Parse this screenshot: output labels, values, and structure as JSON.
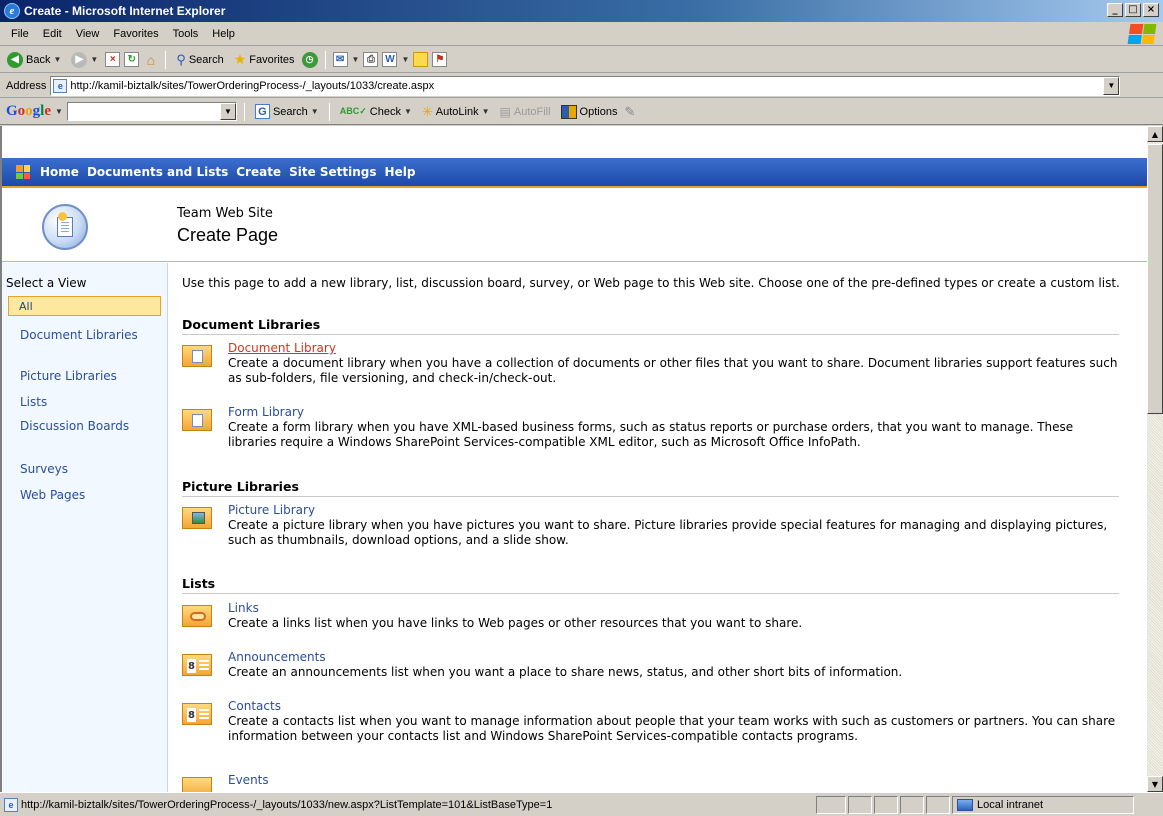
{
  "window": {
    "title": "Create - Microsoft Internet Explorer",
    "minimize": "_",
    "maximize": "□",
    "close": "×"
  },
  "menu": [
    "File",
    "Edit",
    "View",
    "Favorites",
    "Tools",
    "Help"
  ],
  "toolbar": {
    "back": "Back",
    "search": "Search",
    "favorites": "Favorites"
  },
  "address": {
    "label": "Address",
    "url": "http://kamil-biztalk/sites/TowerOrderingProcess-/_layouts/1033/create.aspx"
  },
  "googlebar": {
    "logo": "Google",
    "search": "Search",
    "check": "Check",
    "autolink": "AutoLink",
    "autofill": "AutoFill",
    "options": "Options"
  },
  "sp_nav": [
    "Home",
    "Documents and Lists",
    "Create",
    "Site Settings",
    "Help"
  ],
  "header": {
    "site_name": "Team Web Site",
    "page_title": "Create Page"
  },
  "left_nav": {
    "heading": "Select a View",
    "selected": "All",
    "items": [
      "Document Libraries",
      "Picture Libraries",
      "Lists",
      "Discussion Boards",
      "Surveys",
      "Web Pages"
    ]
  },
  "main": {
    "intro": "Use this page to add a new library, list, discussion board, survey, or Web page to this Web site. Choose one of the pre-defined types or create a custom list.",
    "sections": {
      "doclibs": "Document Libraries",
      "piclibs": "Picture Libraries",
      "lists": "Lists"
    },
    "items": {
      "doclib": {
        "title": "Document Library",
        "desc": "Create a document library when you have a collection of documents or other files that you want to share. Document libraries support features such as sub-folders, file versioning, and check-in/check-out."
      },
      "formlib": {
        "title": "Form Library",
        "desc": "Create a form library when you have XML-based business forms, such as status reports or purchase orders, that you want to manage. These libraries require a Windows SharePoint Services-compatible XML editor, such as Microsoft Office InfoPath."
      },
      "piclib": {
        "title": "Picture Library",
        "desc": "Create a picture library when you have pictures you want to share.  Picture libraries provide special features for managing and displaying pictures, such as thumbnails, download options, and a slide show."
      },
      "links": {
        "title": "Links",
        "desc": "Create a links list when you have links to Web pages or other resources that you want to share."
      },
      "announcements": {
        "title": "Announcements",
        "desc": "Create an announcements list when you want a place to share news, status, and other short bits of information."
      },
      "contacts": {
        "title": "Contacts",
        "desc": "Create a contacts list when you want to manage information about people that your team works with such as customers or partners. You can share information between your contacts list and Windows SharePoint Services-compatible contacts programs."
      },
      "events": {
        "title": "Events"
      }
    }
  },
  "status": {
    "url": "http://kamil-biztalk/sites/TowerOrderingProcess-/_layouts/1033/new.aspx?ListTemplate=101&ListBaseType=1",
    "zone": "Local intranet"
  }
}
